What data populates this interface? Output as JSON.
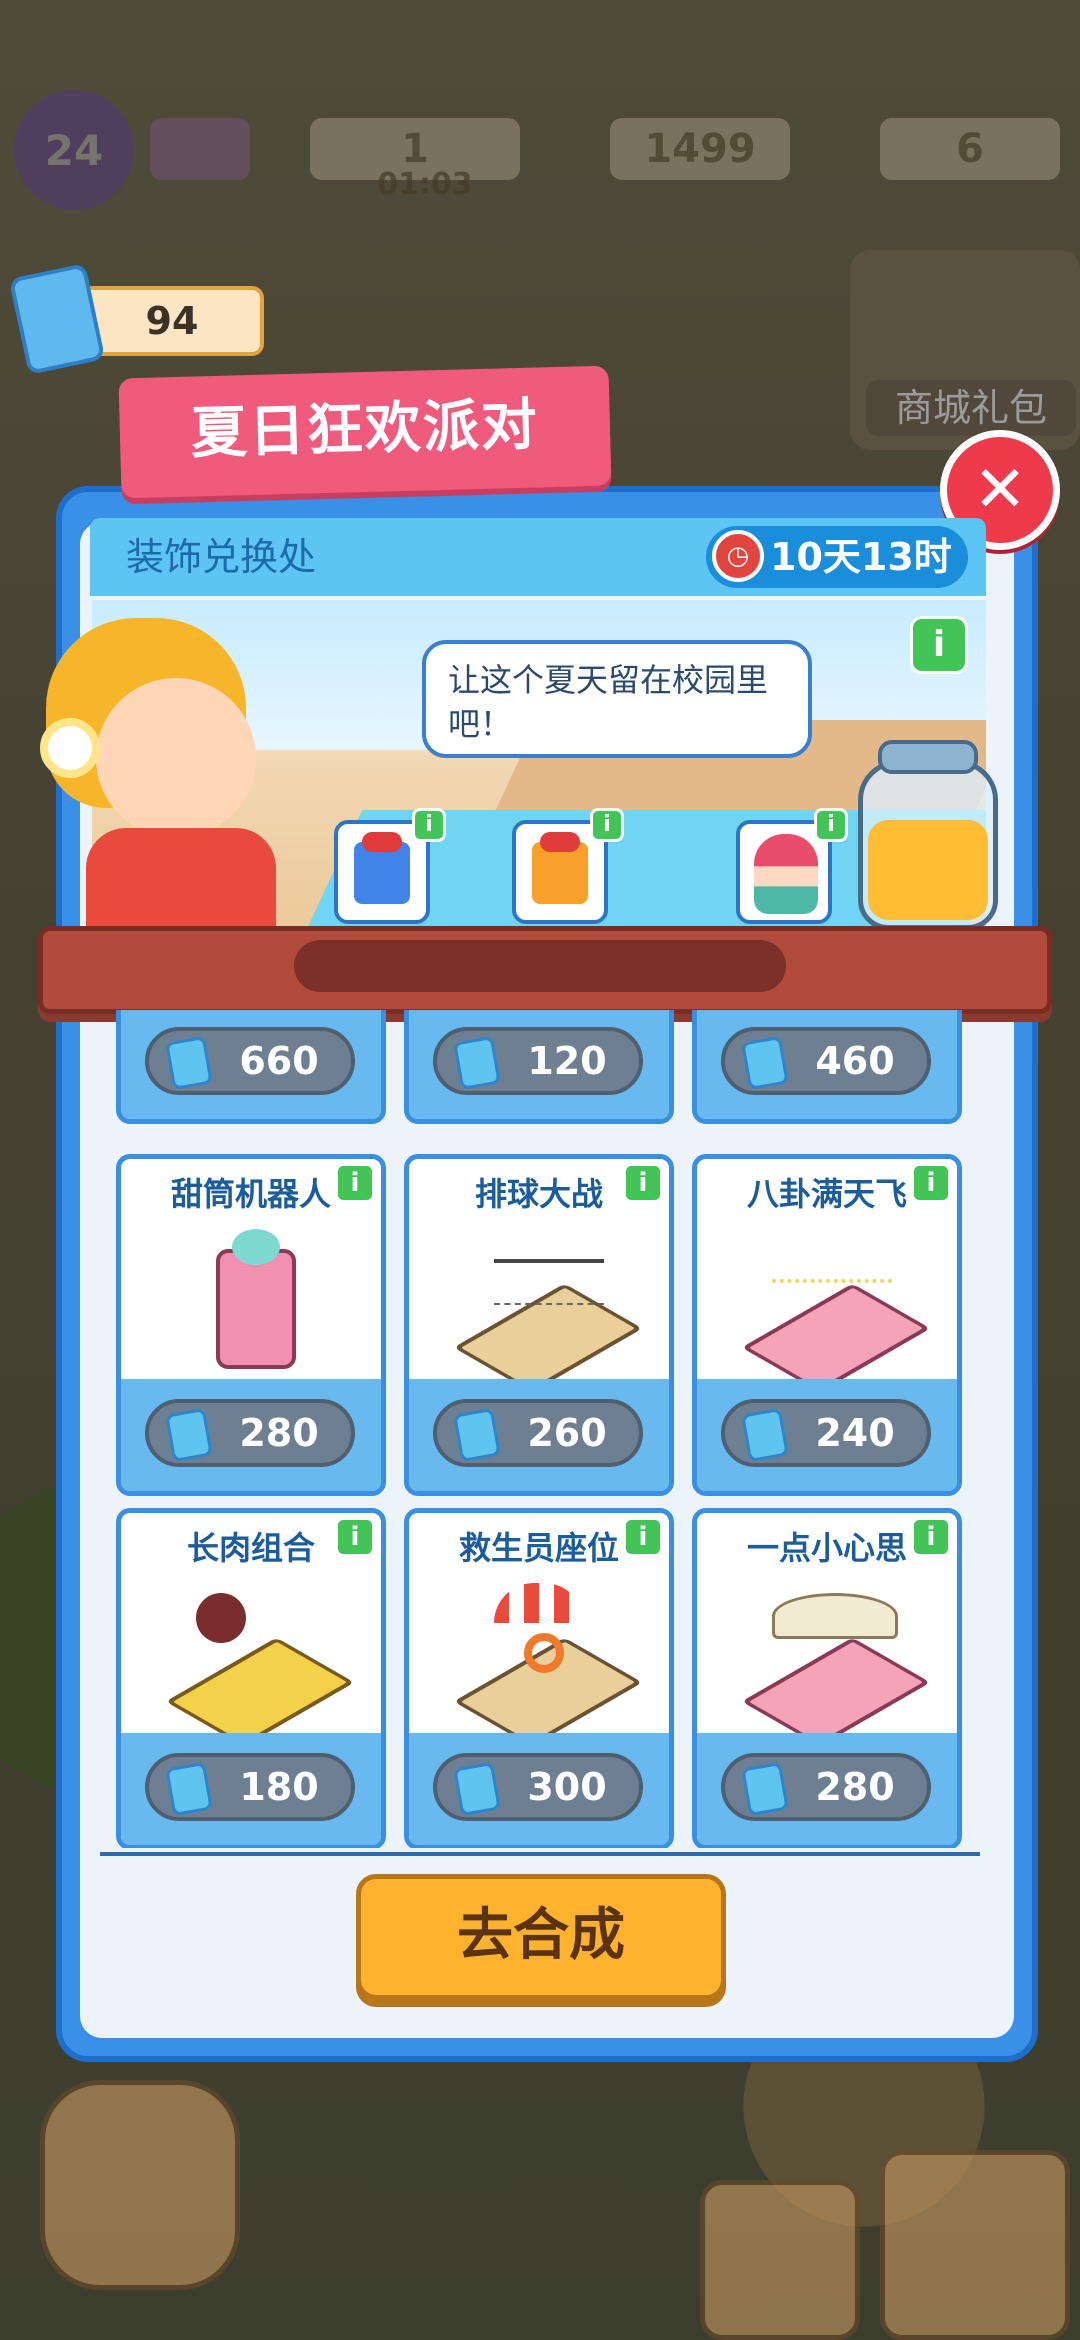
{
  "hud": {
    "level": "24",
    "energy": "1",
    "energy_timer": "01:03",
    "cash": "1499",
    "gems": "6",
    "tickets": "94",
    "shop_label": "商城礼包"
  },
  "event": {
    "title": "夏日狂欢派对",
    "section_title": "装饰兑换处",
    "timer": "10天13时",
    "speech": "让这个夏天留在校园里吧！"
  },
  "top_row_prices": [
    "660",
    "120",
    "460"
  ],
  "items": [
    {
      "name": "甜筒机器人",
      "price": "280"
    },
    {
      "name": "排球大战",
      "price": "260"
    },
    {
      "name": "八卦满天飞",
      "price": "240"
    },
    {
      "name": "长肉组合",
      "price": "180"
    },
    {
      "name": "救生员座位",
      "price": "300"
    },
    {
      "name": "一点小心思",
      "price": "280"
    }
  ],
  "action_button": "去合成",
  "icons": {
    "close": "close-icon",
    "info": "info-icon",
    "ticket": "ticket-icon",
    "clock": "clock-icon"
  },
  "colors": {
    "panel_blue": "#3a8fe6",
    "title_pink": "#f05a7c",
    "button_orange": "#ffb22d",
    "close_red": "#ee3a4a",
    "info_green": "#42c456"
  }
}
